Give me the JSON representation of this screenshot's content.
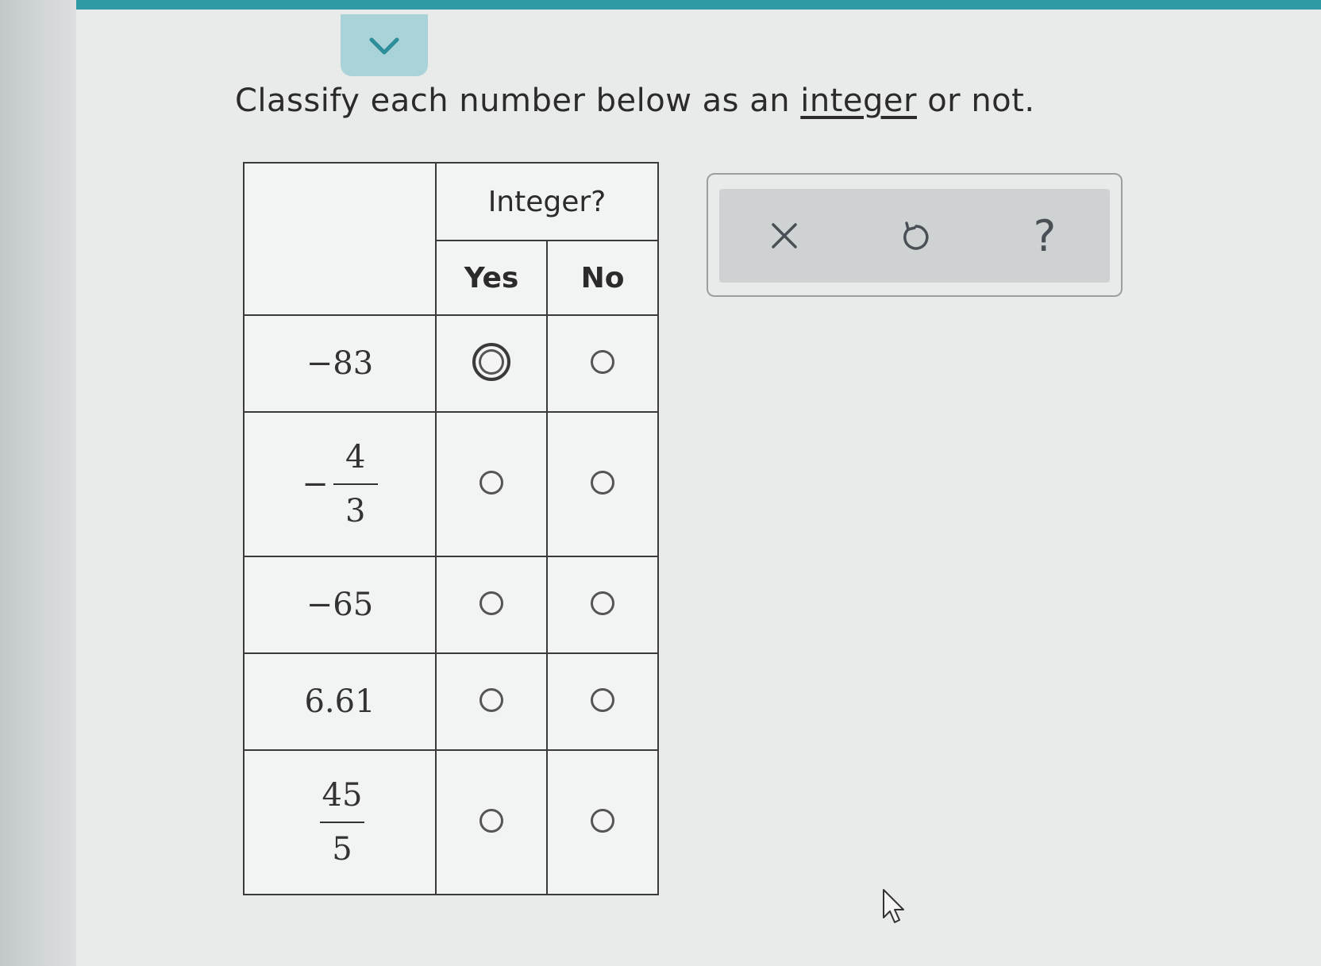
{
  "question": {
    "prefix": "Classify each number below as an ",
    "link": "integer",
    "suffix": " or not."
  },
  "table": {
    "group_header": "Integer?",
    "col_yes": "Yes",
    "col_no": "No",
    "rows": [
      {
        "kind": "plain",
        "text": "−83",
        "yes_focused": true
      },
      {
        "kind": "fraction",
        "sign": "−",
        "num": "4",
        "den": "3",
        "yes_focused": false
      },
      {
        "kind": "plain",
        "text": "−65",
        "yes_focused": false
      },
      {
        "kind": "plain",
        "text": "6.61",
        "yes_focused": false
      },
      {
        "kind": "fraction",
        "sign": "",
        "num": "45",
        "den": "5",
        "yes_focused": false
      }
    ]
  },
  "toolbar": {
    "help_label": "?"
  },
  "colors": {
    "accent": "#2e9aa6",
    "tab": "#a9d3d8",
    "icon": "#4a4f55"
  },
  "icons": {
    "collapse": "chevron-down-icon",
    "clear": "close-icon",
    "undo": "undo-icon",
    "help": "help-icon"
  }
}
